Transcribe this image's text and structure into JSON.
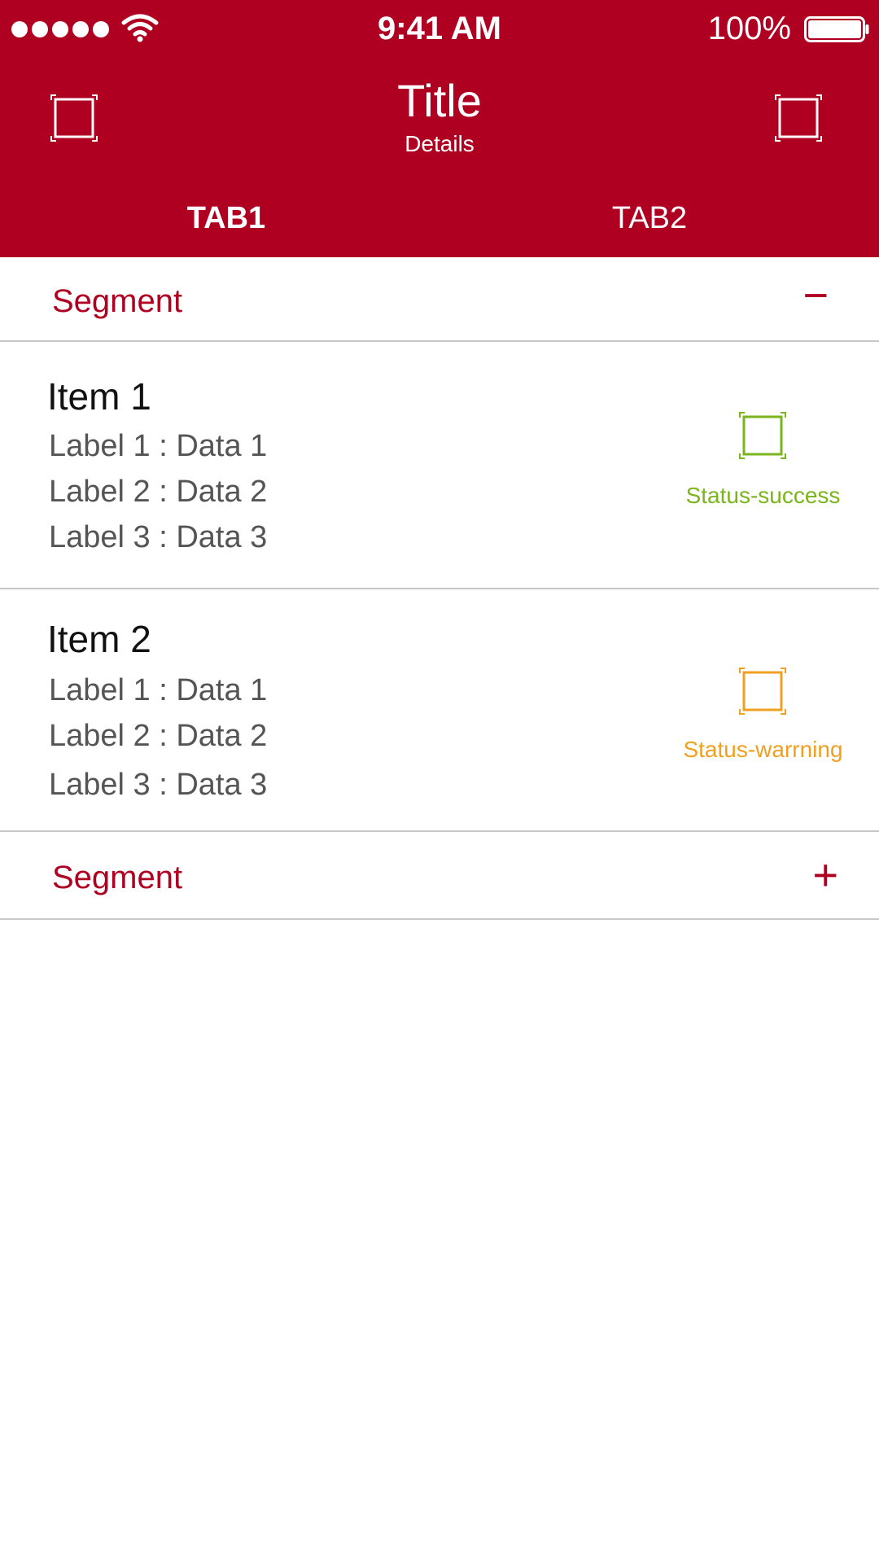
{
  "status_bar": {
    "time": "9:41 AM",
    "battery": "100%",
    "signal_icon": "signal-dots-icon",
    "wifi_icon": "wifi-icon",
    "battery_icon": "battery-icon"
  },
  "header": {
    "title": "Title",
    "subtitle": "Details",
    "left_icon": "placeholder-frame-icon",
    "right_icon": "placeholder-frame-icon",
    "background_color": "#b00022"
  },
  "tabs": [
    {
      "label": "TAB1",
      "active": true
    },
    {
      "label": "TAB2",
      "active": false
    }
  ],
  "segments": [
    {
      "label": "Segment",
      "toggle": "−",
      "expanded": true
    },
    {
      "label": "Segment",
      "toggle": "+",
      "expanded": false
    }
  ],
  "items": [
    {
      "title": "Item 1",
      "lines": [
        "Label 1 : Data 1",
        "Label 2 : Data 2",
        "Label 3 : Data 3"
      ],
      "status": "Status-success",
      "status_color": "#7ab51d",
      "status_icon": "placeholder-frame-icon"
    },
    {
      "title": "Item 2",
      "lines": [
        "Label 1 : Data 1",
        "Label 2 : Data 2",
        "Label 3 : Data 3"
      ],
      "status": "Status-warrning",
      "status_color": "#f0a020",
      "status_icon": "placeholder-frame-icon"
    }
  ]
}
